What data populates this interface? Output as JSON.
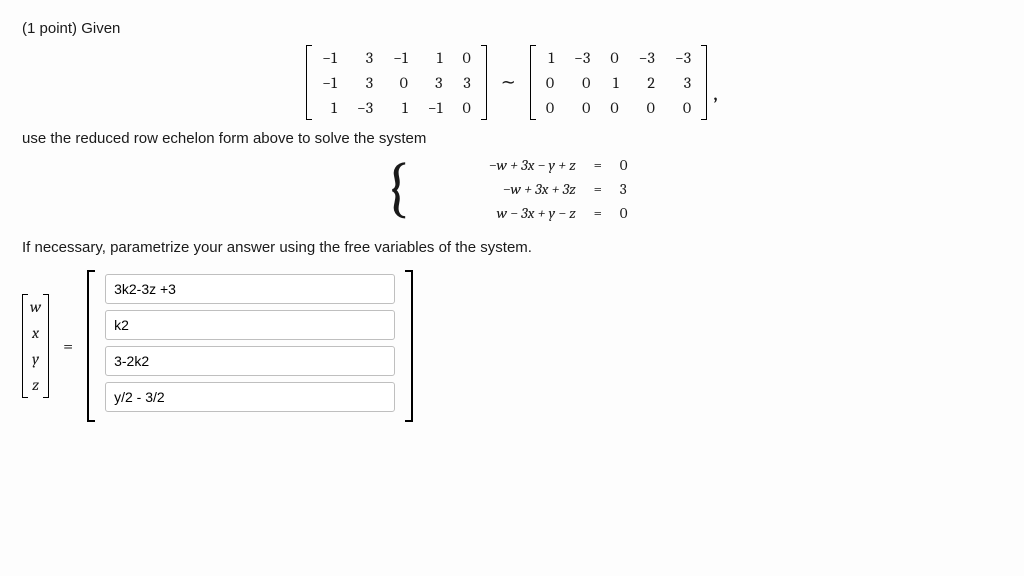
{
  "header": "(1 point) Given",
  "matrix_a": [
    [
      "−1",
      "3",
      "−1",
      "1",
      "0"
    ],
    [
      "−1",
      "3",
      "0",
      "3",
      "3"
    ],
    [
      "1",
      "−3",
      "1",
      "−1",
      "0"
    ]
  ],
  "rel_symbol": "∼",
  "matrix_b": [
    [
      "1",
      "−3",
      "0",
      "−3",
      "−3"
    ],
    [
      "0",
      "0",
      "1",
      "2",
      "3"
    ],
    [
      "0",
      "0",
      "0",
      "0",
      "0"
    ]
  ],
  "comma": ",",
  "instruction1": "use the reduced row echelon form above to solve the system",
  "system": {
    "rows": [
      {
        "lhs": "−w + 3x − y + z",
        "eq": "=",
        "rhs": "0"
      },
      {
        "lhs": "−w + 3x + 3z",
        "eq": "=",
        "rhs": "3"
      },
      {
        "lhs": "w − 3x + y − z",
        "eq": "=",
        "rhs": "0"
      }
    ]
  },
  "instruction2": "If necessary, parametrize your answer using the free variables of the system.",
  "vars": [
    "w",
    "x",
    "y",
    "z"
  ],
  "eq": "=",
  "answers": {
    "w": "3k2-3z +3",
    "x": "k2",
    "y": "3-2k2",
    "z": "y/2 - 3/2"
  }
}
